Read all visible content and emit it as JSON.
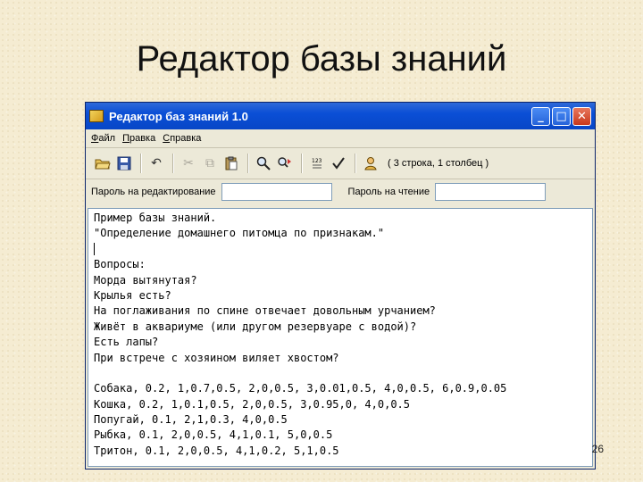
{
  "slide": {
    "title": "Редактор базы знаний",
    "number": "26"
  },
  "window": {
    "title": "Редактор баз знаний 1.0",
    "controls": {
      "minimize": "_",
      "maximize": "□",
      "close": "✕"
    }
  },
  "menu": {
    "items": [
      {
        "label": "Файл"
      },
      {
        "label": "Правка"
      },
      {
        "label": "Справка"
      }
    ]
  },
  "toolbar": {
    "status": "( 3 строка, 1 столбец )",
    "icons": {
      "open": "open-folder-icon",
      "save": "save-icon",
      "undo": "undo-icon",
      "cut": "cut-icon",
      "copy": "copy-icon",
      "paste": "paste-icon",
      "find": "find-icon",
      "replace": "replace-icon",
      "numbering": "numbering-icon",
      "check": "check-icon",
      "run": "run-icon"
    }
  },
  "passwords": {
    "edit_label": "Пароль на редактирование",
    "edit_value": "",
    "read_label": "Пароль на чтение",
    "read_value": ""
  },
  "editor": {
    "lines": [
      "Пример базы знаний.",
      "\"Определение домашнего питомца по признакам.\"",
      "",
      "Вопросы:",
      "Морда вытянутая?",
      "Крылья есть?",
      "На поглаживания по спине отвечает довольным урчанием?",
      "Живёт в аквариуме (или другом резервуаре с водой)?",
      "Есть лапы?",
      "При встрече с хозяином виляет хвостом?",
      "",
      "Собака, 0.2, 1,0.7,0.5, 2,0,0.5, 3,0.01,0.5, 4,0,0.5, 6,0.9,0.05",
      "Кошка, 0.2, 1,0.1,0.5, 2,0,0.5, 3,0.95,0, 4,0,0.5",
      "Попугай, 0.1, 2,1,0.3, 4,0,0.5",
      "Рыбка, 0.1, 2,0,0.5, 4,1,0.1, 5,0,0.5",
      "Тритон, 0.1, 2,0,0.5, 4,1,0.2, 5,1,0.5"
    ]
  }
}
